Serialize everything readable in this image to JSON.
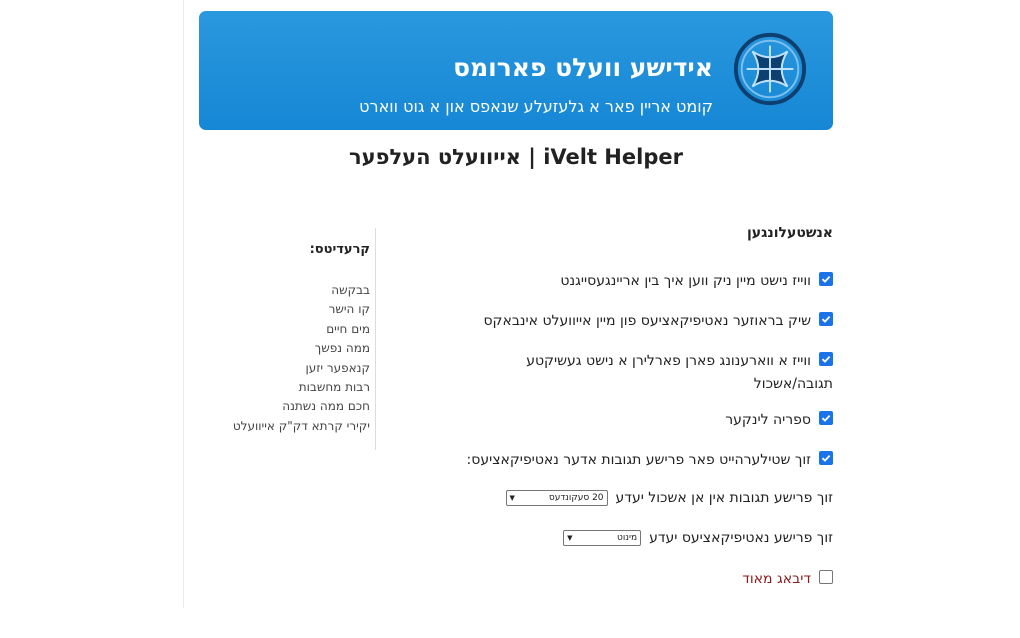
{
  "banner": {
    "title": "אידישע וועלט פארומס",
    "subtitle": "קומט אריין פאר א גלעזעלע שנאפס און א גוט ווארט"
  },
  "page_title": "iVelt Helper | אייוועלט העלפער",
  "settings": {
    "heading": "אנשטעלונגען",
    "options": [
      {
        "label": "ווייז נישט מיין ניק ווען איך בין אריינגעסייגנט",
        "checked": true
      },
      {
        "label": "שיק בראוזער נאטיפיקאציעס פון מיין אייוועלט אינבאקס",
        "checked": true
      },
      {
        "label": "ווייז א ווארענונג פארן פארלירן א נישט געשיקטע",
        "label_line2": "תגובה/אשכול",
        "checked": true
      },
      {
        "label": "ספריה לינקער",
        "checked": true
      },
      {
        "label": "זוך שטילערהייט פאר פרישע תגובות אדער נאטיפיקאציעס:",
        "checked": true
      }
    ],
    "sub_options": [
      {
        "label": "זוך פרישע תגובות אין אן אשכול יעדע",
        "value": "20 סעקונדעס"
      },
      {
        "label": "זוך פרישע נאטיפיקאציעס יעדע",
        "value": "מינוט"
      }
    ],
    "debug": {
      "label": "דיבאג מאוד",
      "checked": false
    }
  },
  "credits": {
    "heading": "קרעדיטס:",
    "items": [
      "בבקשה",
      "קו הישר",
      "מים חיים",
      "ממה נפשך",
      "קנאפער יזען",
      "רבות מחשבות",
      "חכם ממה נשתנה",
      "יקירי קרתא דק\"ק אייוועלט"
    ]
  },
  "colors": {
    "banner": "#1a8cd8",
    "checkbox": "#1a73e8",
    "debug_label": "#8b1c1c"
  },
  "icons": {
    "logo": "ivelt-logo",
    "check": "checkmark-icon",
    "select_arrow": "chevron-down-icon"
  }
}
